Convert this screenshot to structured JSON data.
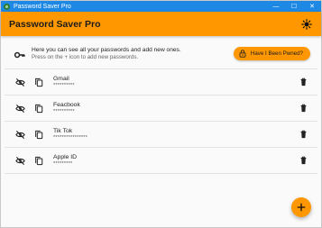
{
  "window": {
    "title": "Password Saver Pro",
    "minimize": "—",
    "maximize": "☐",
    "close": "✕"
  },
  "appbar": {
    "title": "Password Saver Pro",
    "theme_icon": "brightness-icon"
  },
  "intro": {
    "line1": "Here you can see all your passwords and add new ones.",
    "line2": "Press on the + icon to add new passwords.",
    "icon": "key-icon",
    "pwned_button": "Have I Been Pwned?"
  },
  "passwords": [
    {
      "name": "Gmail",
      "masked": "**********"
    },
    {
      "name": "Feacbook",
      "masked": "**********"
    },
    {
      "name": "Tik Tok",
      "masked": "****************"
    },
    {
      "name": "Apple ID",
      "masked": "*********"
    }
  ],
  "colors": {
    "titlebar": "#1e88e5",
    "accent": "#ff9800"
  },
  "fab": {
    "icon": "plus-icon"
  }
}
